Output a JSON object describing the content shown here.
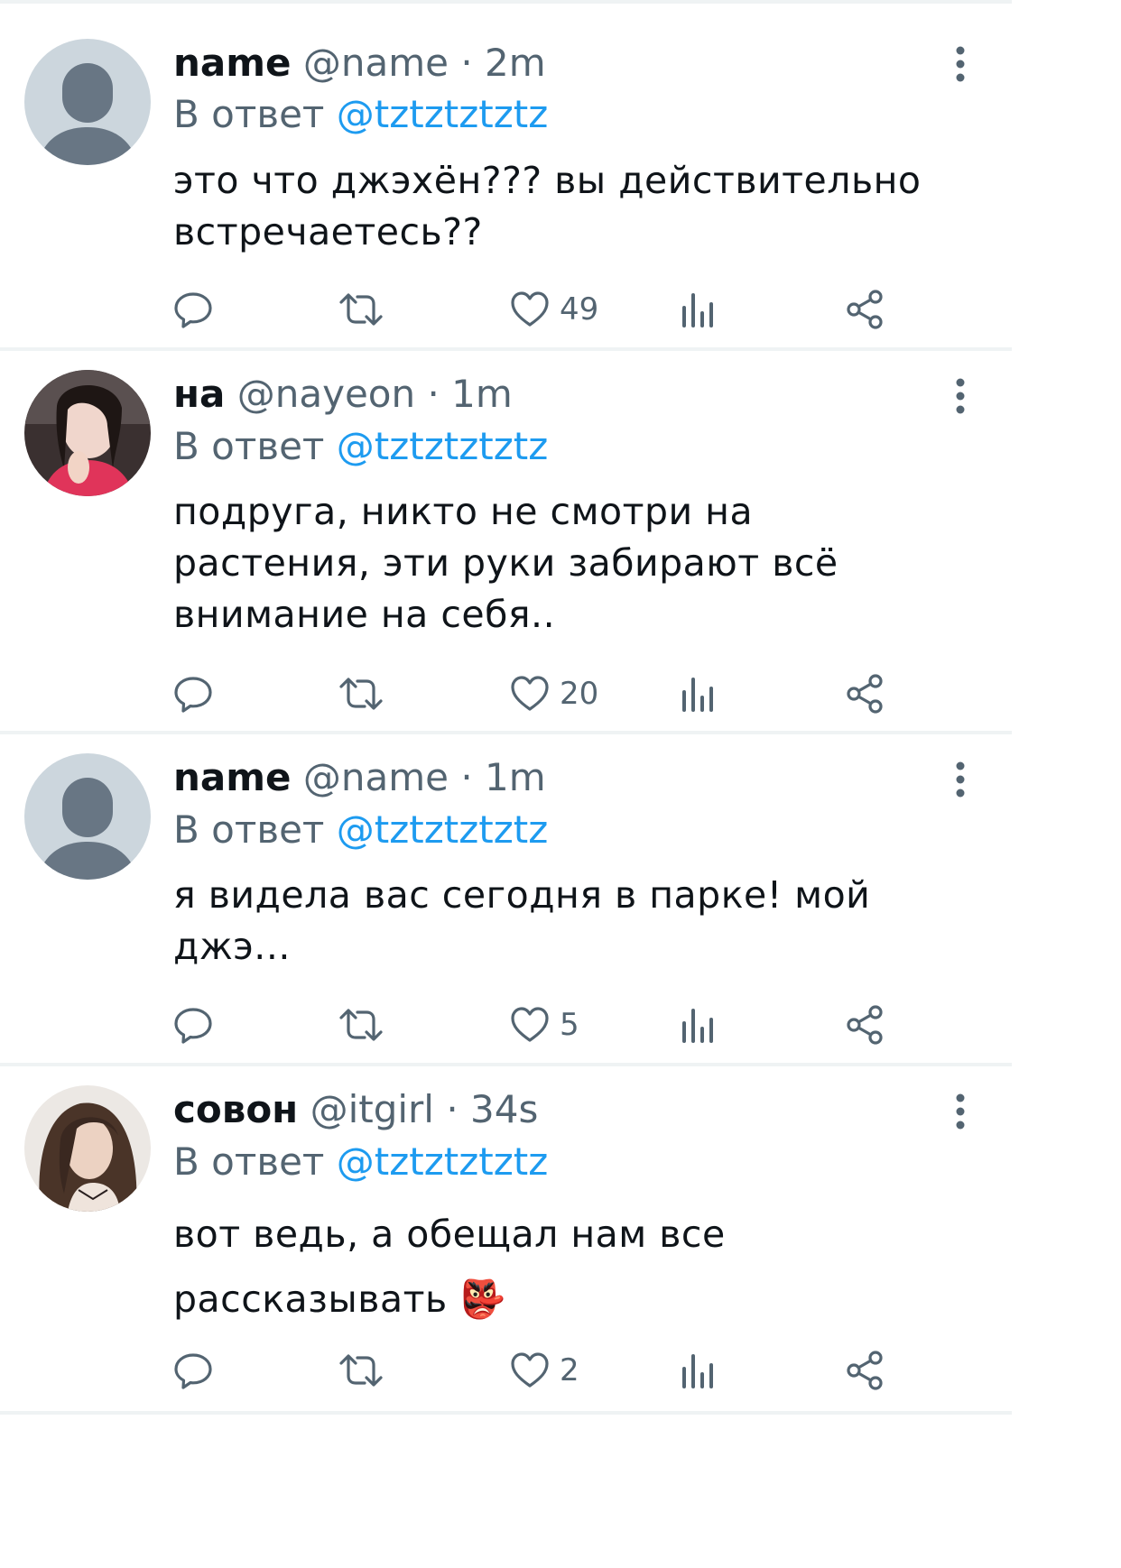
{
  "tweets": [
    {
      "name": "name",
      "handle": "@name",
      "time": "· 2m",
      "reply_prefix": "В ответ",
      "reply_to": "@tztztztztz",
      "text": "это что джэхён??? вы действительно встречаетесь??",
      "likes": "49",
      "avatar": "default-avatar"
    },
    {
      "name": "на",
      "handle": "@nayeon",
      "time": "· 1m",
      "reply_prefix": "В ответ",
      "reply_to": "@tztztztztz",
      "text": "подруга, никто не смотри на растения, эти руки забирают всё внимание на себя..",
      "likes": "20",
      "avatar": "photo-avatar"
    },
    {
      "name": "name",
      "handle": "@name",
      "time": "· 1m",
      "reply_prefix": "В ответ",
      "reply_to": "@tztztztztz",
      "text": "я видела вас сегодня в парке! мой джэ...",
      "likes": "5",
      "avatar": "default-avatar"
    },
    {
      "name": "совон",
      "handle": "@itgirl",
      "time": "· 34s",
      "reply_prefix": "В ответ",
      "reply_to": "@tztztztztz",
      "text": "вот ведь, а обещал нам все рассказывать 👺",
      "likes": "2",
      "avatar": "photo-avatar"
    }
  ],
  "colors": {
    "text": "#0f1419",
    "secondary": "#536471",
    "link": "#1d9bf0",
    "divider": "#eff3f4",
    "avatar_bg": "#ccd6dd",
    "avatar_fg": "#687684"
  },
  "icons": [
    "reply-icon",
    "retweet-icon",
    "like-icon",
    "views-icon",
    "share-icon",
    "more-icon"
  ]
}
